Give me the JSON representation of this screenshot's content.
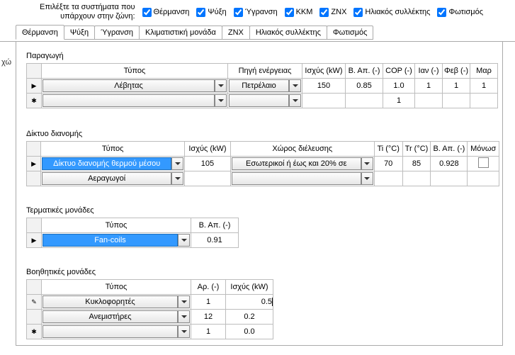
{
  "top": {
    "prompt": "Επιλέξτε τα συστήματα που\nυπάρχουν στην ζώνη:",
    "checks": [
      {
        "label": "Θέρμανση",
        "on": true
      },
      {
        "label": "Ψύξη",
        "on": true
      },
      {
        "label": "Ύγρανση",
        "on": true
      },
      {
        "label": "ΚΚΜ",
        "on": true
      },
      {
        "label": "ΖΝΧ",
        "on": true
      },
      {
        "label": "Ηλιακός συλλέκτης",
        "on": true
      },
      {
        "label": "Φωτισμός",
        "on": true
      }
    ]
  },
  "tabs": [
    {
      "label": "Θέρμανση",
      "active": true
    },
    {
      "label": "Ψύξη"
    },
    {
      "label": "Ύγρανση"
    },
    {
      "label": "Κλιματιστική μονάδα"
    },
    {
      "label": "ΖΝΧ"
    },
    {
      "label": "Ηλιακός συλλέκτης"
    },
    {
      "label": "Φωτισμός"
    }
  ],
  "side_label": "χώ",
  "sections": {
    "paragogi": {
      "title": "Παραγωγή",
      "headers": {
        "type": "Τύπος",
        "src": "Πηγή ενέργειας",
        "pow": "Ισχύς (kW)",
        "bap": "Β. Απ. (-)",
        "cop": "COP (-)",
        "jan": "Ιαν (-)",
        "feb": "Φεβ (-)",
        "mar": "Μαρ"
      },
      "rows": [
        {
          "type": "Λέβητας",
          "src": "Πετρέλαιο",
          "pow": "150",
          "bap": "0.85",
          "cop": "1.0",
          "jan": "1",
          "feb": "1",
          "mar": "1"
        },
        {
          "type": "",
          "src": "",
          "pow": "",
          "bap": "",
          "cop": "1",
          "jan": "",
          "feb": "",
          "mar": ""
        }
      ]
    },
    "diktyo": {
      "title": "Δίκτυο διανομής",
      "headers": {
        "type": "Τύπος",
        "pow": "Ισχύς (kW)",
        "room": "Χώρος διέλευσης",
        "ti": "Ti (°C)",
        "tr": "Tr (°C)",
        "bap": "Β. Απ. (-)",
        "ins": "Μόνωσ"
      },
      "rows": [
        {
          "type": "Δίκτυο διανομής θερμού μέσου",
          "pow": "105",
          "room": "Εσωτερικοί  ή έως και 20% σε",
          "ti": "70",
          "tr": "85",
          "bap": "0.928",
          "ins": false,
          "selected": true
        },
        {
          "type": "Αεραγωγοί",
          "pow": "",
          "room": "",
          "ti": "",
          "tr": "",
          "bap": "",
          "ins": null
        }
      ]
    },
    "term": {
      "title": "Τερματικές μονάδες",
      "headers": {
        "type": "Τύπος",
        "bap": "Β. Απ. (-)"
      },
      "rows": [
        {
          "type": "Fan-coils",
          "bap": "0.91",
          "selected": true
        }
      ]
    },
    "aux": {
      "title": "Βοηθητικές μονάδες",
      "headers": {
        "type": "Τύπος",
        "n": "Αρ. (-)",
        "pow": "Ισχύς (kW)"
      },
      "rows": [
        {
          "type": "Κυκλοφορητές",
          "n": "1",
          "pow": "0.5"
        },
        {
          "type": "Ανεμιστήρες",
          "n": "12",
          "pow": "0.2"
        },
        {
          "type": "",
          "n": "1",
          "pow": "0.0"
        }
      ]
    }
  }
}
